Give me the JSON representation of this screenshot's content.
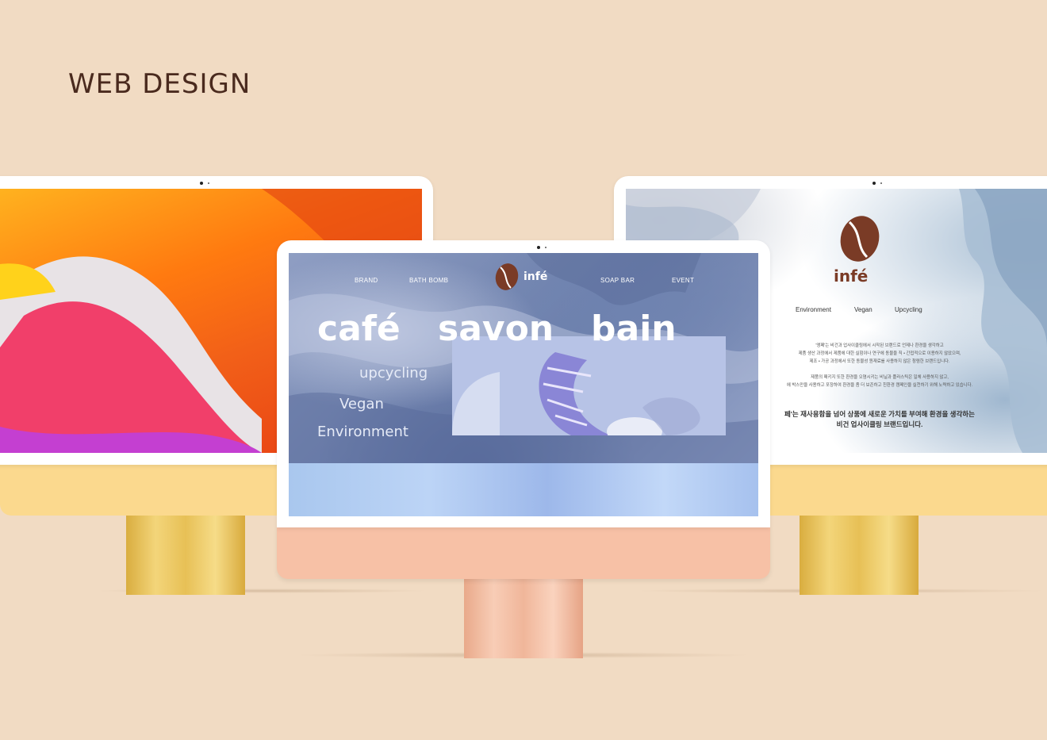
{
  "heading": "WEB DESIGN",
  "colors": {
    "background": "#f1dbc3",
    "heading": "#4a2a1e",
    "brand": "#7a3b26",
    "stand_gold": "#e8c35a",
    "center_chin": "#f7c1a6"
  },
  "center_site": {
    "brand": "infé",
    "nav": [
      "BRAND",
      "BATH BOMB",
      "SOAP BAR",
      "EVENT"
    ],
    "hero_words": [
      "café",
      "savon",
      "bain"
    ],
    "side_words": [
      "upcycling",
      "Vegan",
      "Environment"
    ]
  },
  "right_site": {
    "brand": "infé",
    "tabs": [
      "Environment",
      "Vegan",
      "Upcycling"
    ],
    "paragraph_lines": [
      "'앵페'는 비건과 업사이클링에서 시작된 브랜드로 언제나 환경을 생각하고",
      "제품 생산 과정에서 제품에 대한 실험이나 연구에 동물을 직 • 간접적으로 이용하지 않았으며,",
      "제조 • 가공 과정에서 또한 동물성 원재료를 사용하지 않은 청렴한 브랜드입니다.",
      "제품의 패키지 또한 환경을 오염시키는 비닐과 플라스틱은 일체 사용하지 않고,",
      "에 박스만을 사용하고 포장하여 환경을 좀 더 보존하고 친환경 캠페인을 실천하기 위해 노력하고 있습니다."
    ],
    "statement_lines": [
      "페'는 재사용함을 넘어 상품에 새로운 가치를 부여해 환경을 생각하는",
      "비건 업사이클링 브랜드입니다."
    ]
  }
}
